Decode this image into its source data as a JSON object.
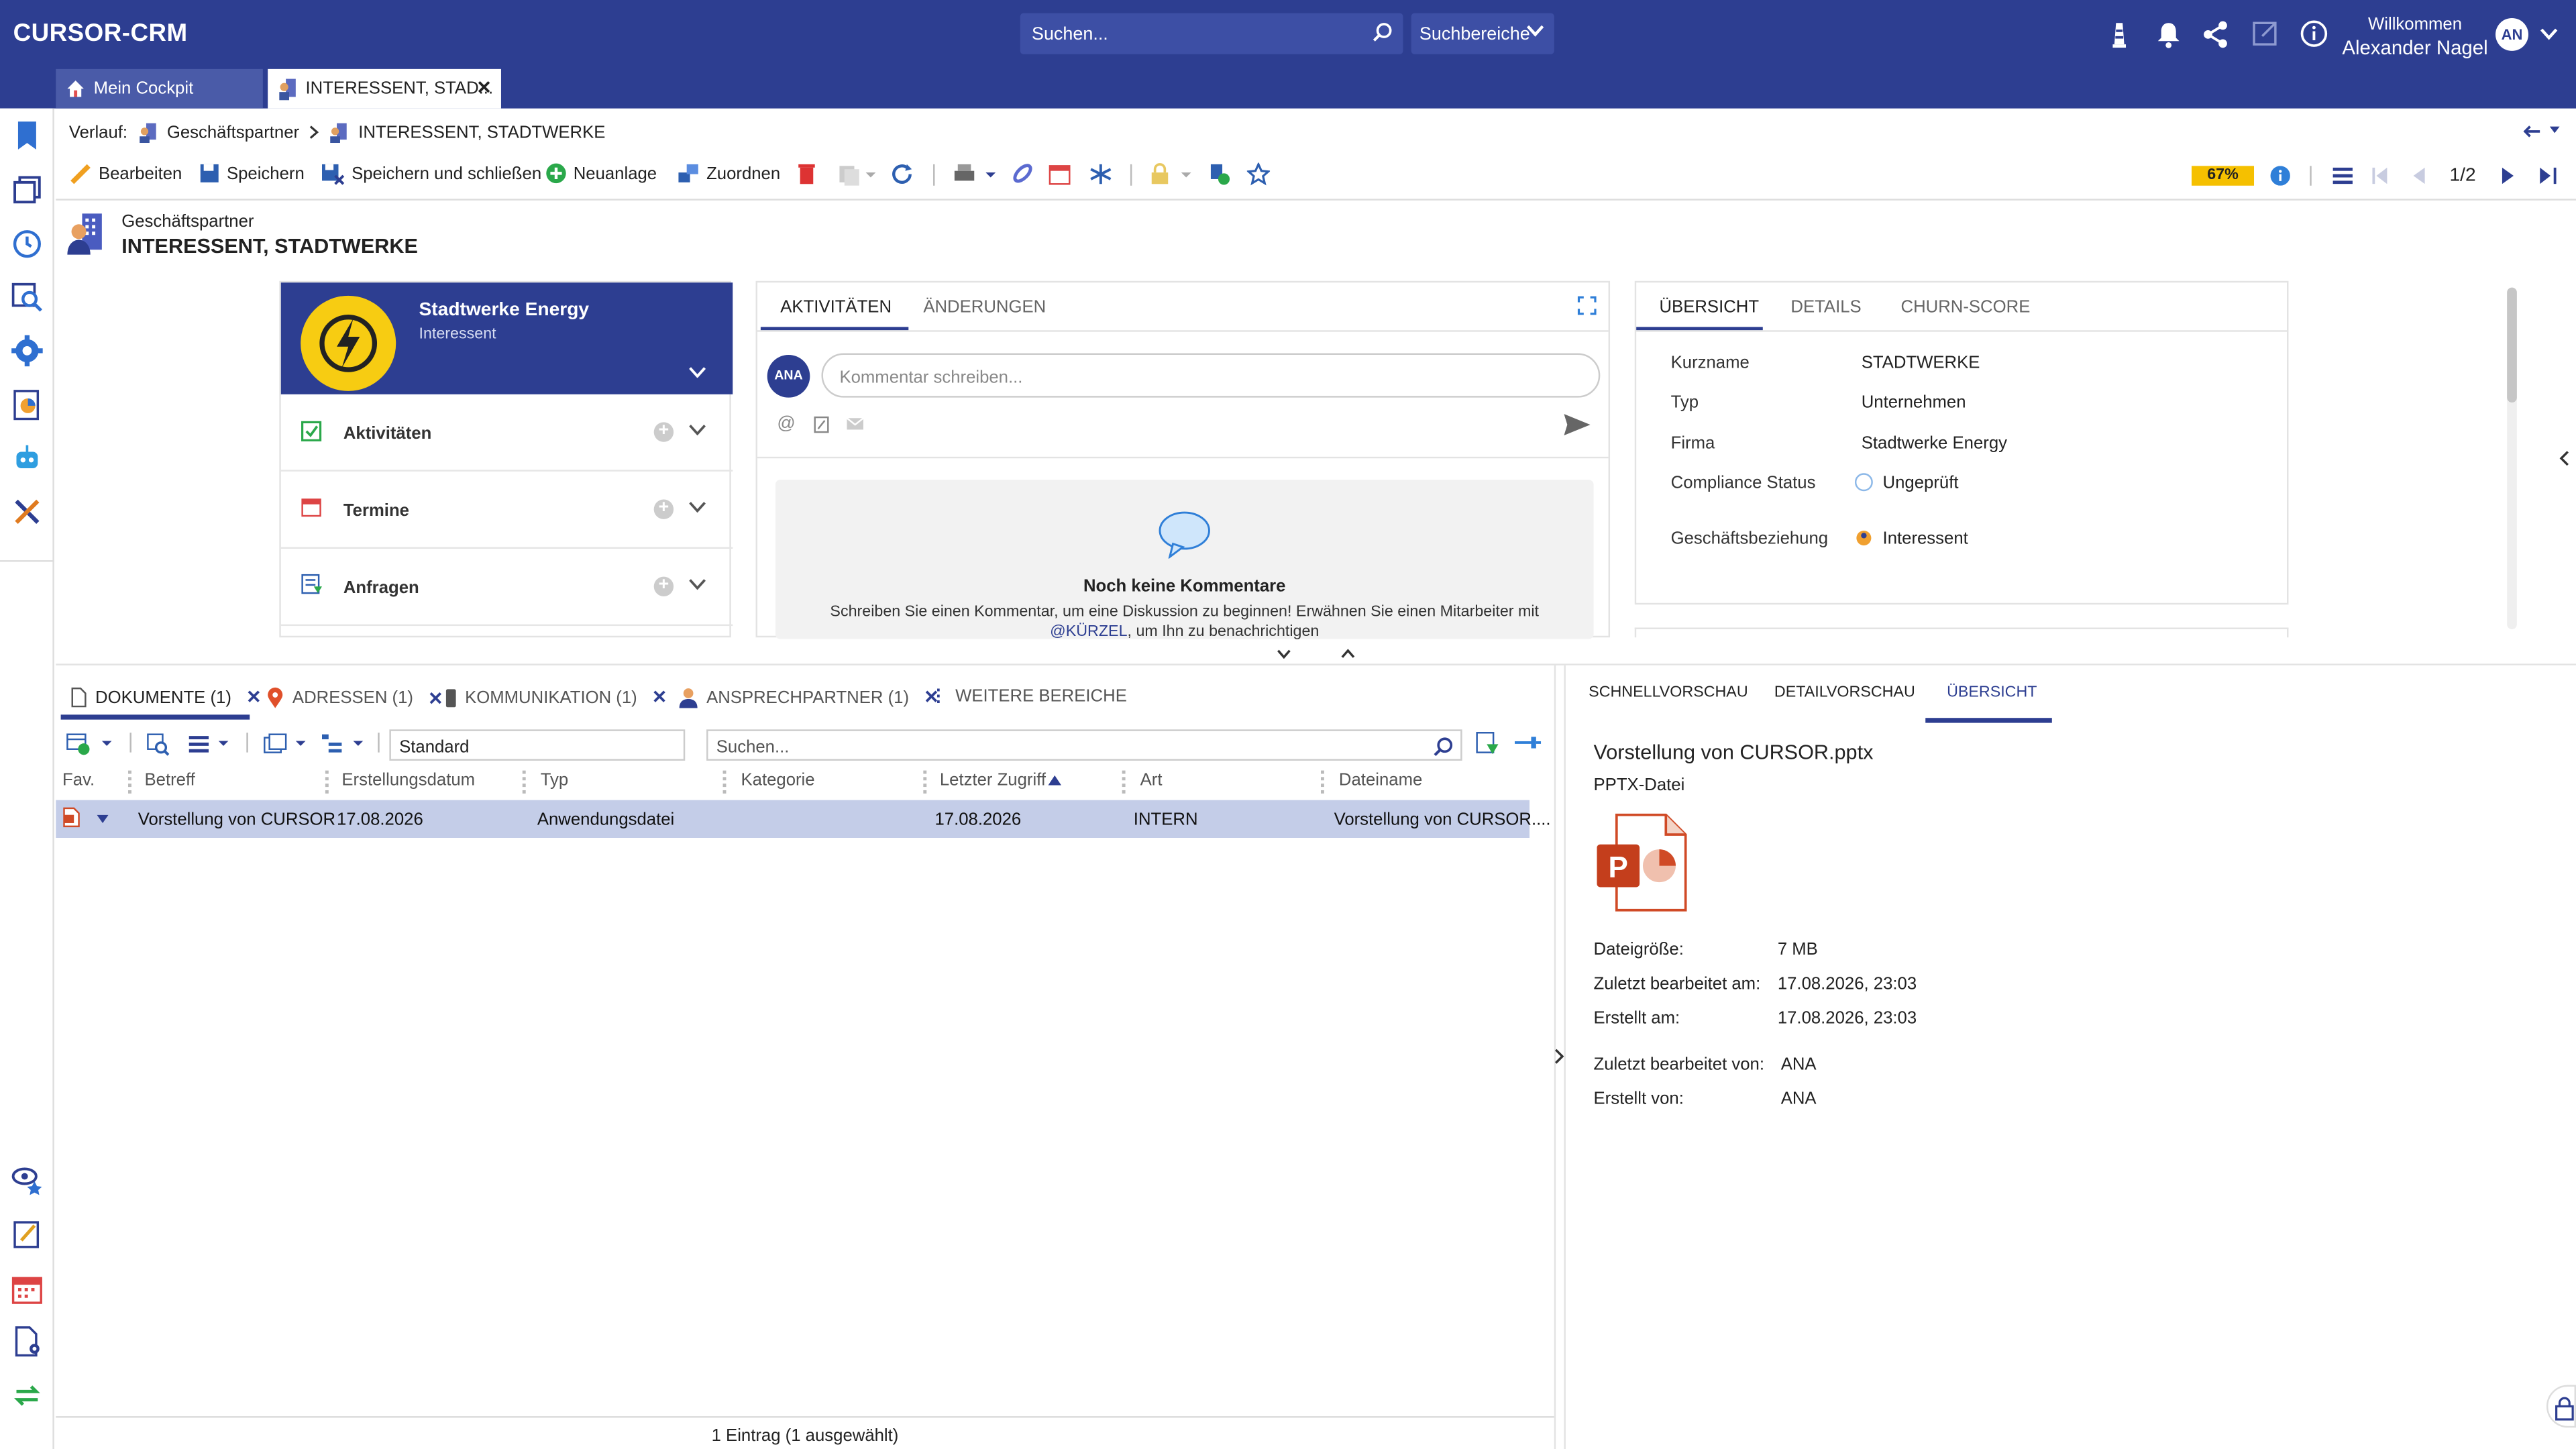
{
  "topbar": {
    "brand": "CURSOR-CRM",
    "search_placeholder": "Suchen...",
    "search_area": "Suchbereiche",
    "welcome": "Willkommen",
    "user_name": "Alexander Nagel",
    "avatar": "AN"
  },
  "tabs": [
    {
      "label": "Mein Cockpit"
    },
    {
      "label": "INTERESSENT, STAD..."
    }
  ],
  "breadcrumb": {
    "prefix": "Verlauf:",
    "item1": "Geschäftspartner",
    "item2": "INTERESSENT, STADTWERKE"
  },
  "toolbar": {
    "edit": "Bearbeiten",
    "save": "Speichern",
    "save_close": "Speichern und schließen",
    "new": "Neuanlage",
    "assign": "Zuordnen",
    "completion": "67%",
    "pager": "1/2"
  },
  "entity": {
    "type": "Geschäftspartner",
    "name": "INTERESSENT, STADTWERKE"
  },
  "card": {
    "title": "Stadtwerke Energy",
    "subtitle": "Interessent",
    "sections": [
      "Aktivitäten",
      "Termine",
      "Anfragen"
    ]
  },
  "activity": {
    "tabs": [
      "AKTIVITÄTEN",
      "ÄNDERUNGEN"
    ],
    "avatar": "ANA",
    "comment_placeholder": "Kommentar schreiben...",
    "empty_title": "Noch keine Kommentare",
    "empty_text_1": "Schreiben Sie einen Kommentar, um eine Diskussion zu beginnen! Erwähnen Sie einen Mitarbeiter mit",
    "empty_mention": "@KÜRZEL",
    "empty_text_2": ", um Ihn zu benachrichtigen"
  },
  "overview": {
    "tabs": [
      "ÜBERSICHT",
      "DETAILS",
      "CHURN-SCORE"
    ],
    "fields": [
      {
        "key": "Kurzname",
        "value": "STADTWERKE"
      },
      {
        "key": "Typ",
        "value": "Unternehmen"
      },
      {
        "key": "Firma",
        "value": "Stadtwerke Energy"
      },
      {
        "key": "Compliance Status",
        "value": "Ungeprüft"
      },
      {
        "key": "Geschäftsbeziehung",
        "value": "Interessent"
      }
    ]
  },
  "doc_tabs": [
    "DOKUMENTE (1)",
    "ADRESSEN (1)",
    "KOMMUNIKATION (1)",
    "ANSPRECHPARTNER (1)",
    "WEITERE BEREICHE"
  ],
  "doc_toolbar": {
    "view": "Standard",
    "search_placeholder": "Suchen..."
  },
  "table": {
    "columns": [
      "Fav.",
      "Betreff",
      "Erstellungsdatum",
      "Typ",
      "Kategorie",
      "Letzter Zugriff",
      "Art",
      "Dateiname"
    ],
    "rows": [
      {
        "betreff": "Vorstellung von CURSOR",
        "erstellt": "17.08.2026",
        "typ": "Anwendungsdatei",
        "kategorie": "",
        "zugriff": "17.08.2026",
        "art": "INTERN",
        "datei": "Vorstellung von CURSOR...."
      }
    ],
    "footer": "1 Eintrag (1 ausgewählt)"
  },
  "preview": {
    "tabs": [
      "SCHNELLVORSCHAU",
      "DETAILVORSCHAU",
      "ÜBERSICHT"
    ],
    "title": "Vorstellung von CURSOR.pptx",
    "subtitle": "PPTX-Datei",
    "fields": [
      {
        "key": "Dateigröße:",
        "value": "7 MB"
      },
      {
        "key": "Zuletzt bearbeitet am:",
        "value": "17.08.2026, 23:03"
      },
      {
        "key": "Erstellt am:",
        "value": "17.08.2026, 23:03"
      },
      {
        "key": "Zuletzt bearbeitet von:",
        "value": "ANA"
      },
      {
        "key": "Erstellt von:",
        "value": "ANA"
      }
    ]
  },
  "colors": {
    "brand": "#2d3e91",
    "completion": "#f5c000",
    "selected_row": "#c4cde8"
  }
}
